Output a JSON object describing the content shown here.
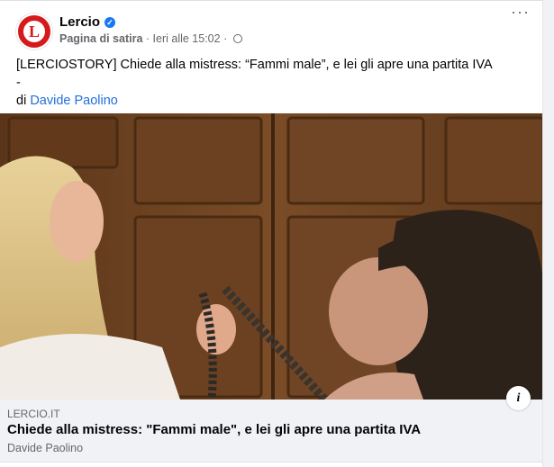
{
  "post": {
    "page_name": "Lercio",
    "category": "Pagina di satira",
    "time": "Ieri alle 15:02",
    "more_label": "···",
    "text_line1": "[LERCIOSTORY] Chiede alla mistress: “Fammi male”, e lei gli apre una partita IVA",
    "text_line2": "-",
    "by_label": "di",
    "author": "Davide Paolino"
  },
  "icons": {
    "avatar": "lercio-logo-icon",
    "verified": "verified-badge-icon",
    "audience": "globe-icon",
    "info": "info-icon"
  },
  "link_preview": {
    "domain": "LERCIO.IT",
    "title": "Chiede alla mistress: \"Fammi male\", e lei gli apre una partita IVA",
    "author": "Davide Paolino"
  },
  "colors": {
    "brand_red": "#d6191b",
    "link_blue": "#216fdb",
    "verified_blue": "#1877f2"
  }
}
